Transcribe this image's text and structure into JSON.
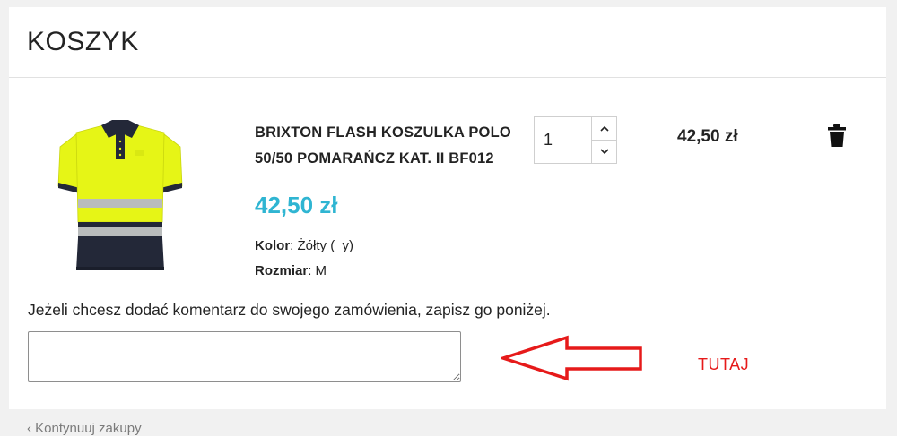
{
  "cart": {
    "title": "KOSZYK"
  },
  "product": {
    "image_icon": "polo-shirt-image",
    "name": "BRIXTON FLASH KOSZULKA POLO 50/50 POMARAŃCZ KAT. II BF012",
    "price": "42,50 zł",
    "attributes": [
      {
        "label": "Kolor",
        "sep": ":",
        "value": "Żółty (_y)"
      },
      {
        "label": "Rozmiar",
        "sep": ":",
        "value": "M"
      }
    ],
    "quantity": "1",
    "line_total": "42,50 zł"
  },
  "icons": {
    "qty_up": "chevron-up-icon",
    "qty_down": "chevron-down-icon",
    "remove": "trash-icon"
  },
  "comment": {
    "label": "Jeżeli chcesz dodać komentarz do swojego zamówienia, zapisz go poniżej.",
    "value": ""
  },
  "annotation": {
    "text": "TUTAJ",
    "color": "#e61a1a"
  },
  "footer": {
    "peek_text": "‹ Kontynuuj zakupy"
  },
  "colors": {
    "price_accent": "#2fb5d2",
    "shirt_yellow": "#e6f516",
    "shirt_navy": "#232838"
  }
}
